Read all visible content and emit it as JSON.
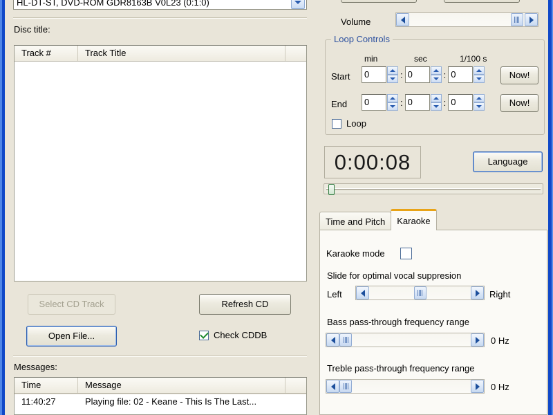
{
  "window": {
    "background_color": "#e9e5d9",
    "border_color": "#1048c8"
  },
  "left_panel": {
    "drive_combo": {
      "value": "HL-DT-ST, DVD-ROM GDR8163B V0L23 (0:1:0)",
      "arrow_icon": "chevron-down-icon"
    },
    "disc_title_label": "Disc title:",
    "disc_title_value": "",
    "track_list": {
      "columns": [
        "Track #",
        "Track Title"
      ],
      "rows": []
    },
    "select_cd_track_button": "Select CD Track",
    "refresh_cd_button": "Refresh CD",
    "open_file_button": "Open File...",
    "check_cddb": {
      "label": "Check CDDB",
      "checked": true
    },
    "messages_label": "Messages:",
    "messages_list": {
      "columns": [
        "Time",
        "Message"
      ],
      "rows": [
        {
          "time": "11:40:27",
          "message": "Playing file: 02 - Keane - This Is The Last..."
        }
      ]
    }
  },
  "right_panel": {
    "volume": {
      "label": "Volume",
      "left_icon": "chevron-left-icon",
      "right_icon": "chevron-right-icon",
      "thumb_percent": 91
    },
    "loop_controls": {
      "legend": "Loop Controls",
      "legend_color": "#2b4f9e",
      "column_headers": [
        "min",
        "sec",
        "1/100 s"
      ],
      "rows": [
        {
          "label": "Start",
          "min": "0",
          "sec": "0",
          "hundredths": "0",
          "now_button": "Now!"
        },
        {
          "label": "End",
          "min": "0",
          "sec": "0",
          "hundredths": "0",
          "now_button": "Now!"
        }
      ],
      "loop_checkbox": {
        "label": "Loop",
        "checked": false
      }
    },
    "timer": "0:00:08",
    "language_button": "Language",
    "track_position": {
      "thumb_percent": 1.5
    },
    "tabs": [
      {
        "label": "Time and Pitch",
        "active": false
      },
      {
        "label": "Karaoke",
        "active": true
      }
    ],
    "karaoke": {
      "mode": {
        "label": "Karaoke mode",
        "checked": false
      },
      "slide_hint": "Slide for optimal vocal suppresion",
      "balance": {
        "left_label": "Left",
        "right_label": "Right",
        "thumb_percent": 50
      },
      "bass": {
        "label": "Bass pass-through frequency range",
        "value": "0 Hz",
        "thumb_percent": 0
      },
      "treble": {
        "label": "Treble pass-through frequency range",
        "value": "0 Hz",
        "thumb_percent": 0
      }
    }
  }
}
